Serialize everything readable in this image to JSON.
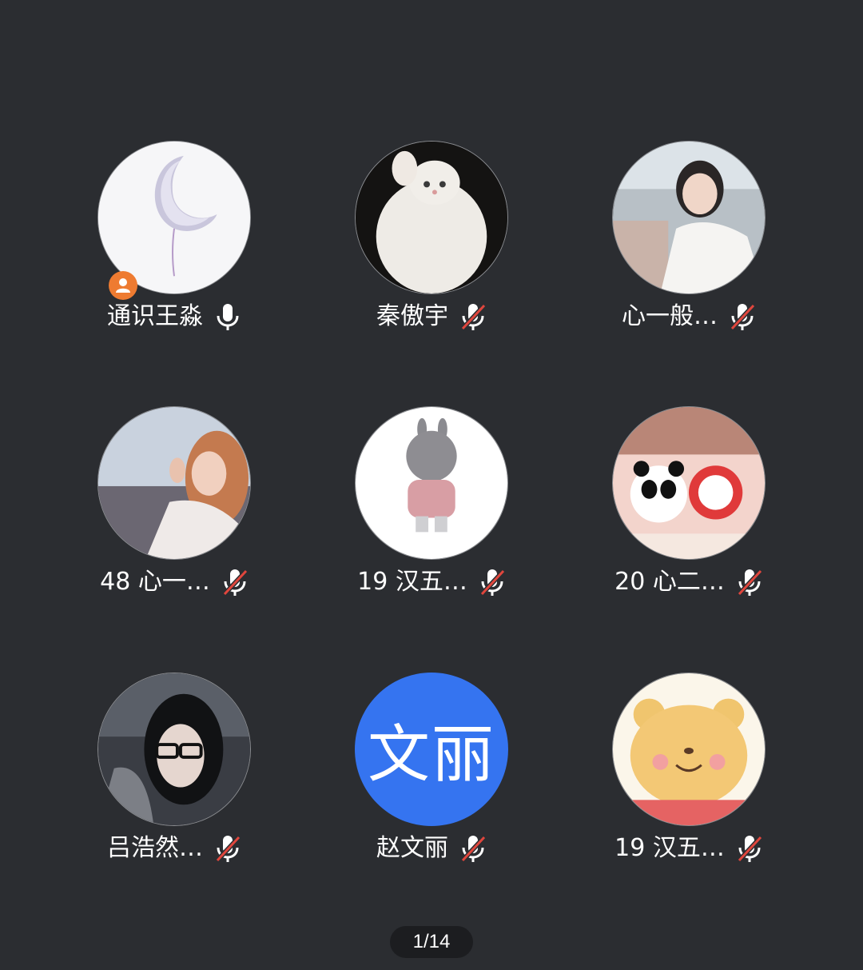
{
  "participants": [
    {
      "name": "通识王淼",
      "mic": "mic-on-icon",
      "avatar": "moon-balloon-photo",
      "host": true
    },
    {
      "name": "秦傲宇",
      "mic": "mic-muted-icon",
      "avatar": "white-kitten-photo"
    },
    {
      "name": "心一般…",
      "mic": "mic-muted-icon",
      "avatar": "girl-photo"
    },
    {
      "name": "48 心一…",
      "mic": "mic-muted-icon",
      "avatar": "girl-in-car-photo"
    },
    {
      "name": "19 汉五…",
      "mic": "mic-muted-icon",
      "avatar": "cartoon-kid-photo"
    },
    {
      "name": "20 心二…",
      "mic": "mic-muted-icon",
      "avatar": "panda-mascots-photo"
    },
    {
      "name": "吕浩然…",
      "mic": "mic-muted-icon",
      "avatar": "woman-glasses-photo"
    },
    {
      "name": "赵文丽",
      "mic": "mic-muted-icon",
      "avatar_text": "文丽",
      "avatar_color": "#3574f0"
    },
    {
      "name": "19 汉五…",
      "mic": "mic-muted-icon",
      "avatar": "cartoon-bear-photo"
    }
  ],
  "pagination": {
    "label": "1/14"
  },
  "colors": {
    "background": "#2b2d31",
    "host_badge": "#ee7b31",
    "muted_slash": "#e0463d"
  }
}
